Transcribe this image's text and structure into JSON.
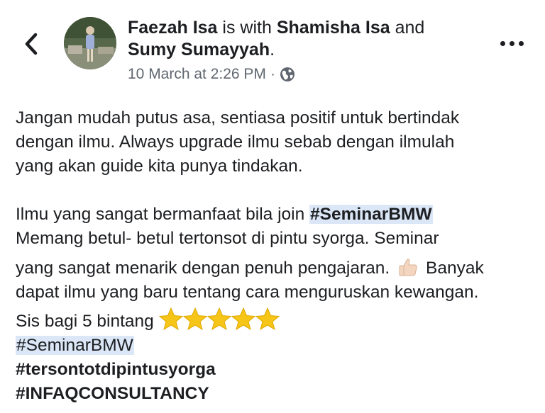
{
  "header": {
    "author": "Faezah Isa",
    "with_text": "is with",
    "tagged_1": "Shamisha Isa",
    "and_text": "and",
    "tagged_2": "Sumy Sumayyah",
    "period": ".",
    "timestamp": "10 March at 2:26 PM",
    "separator": "·",
    "privacy_icon": "globe-icon",
    "back_icon": "chevron-left-icon",
    "more_icon": "more-horizontal-icon"
  },
  "post": {
    "paragraph_1": [
      "Jangan mudah putus asa, sentiasa positif untuk bertindak",
      "dengan ilmu. Always upgrade ilmu sebab dengan ilmulah",
      "yang akan guide kita punya tindakan."
    ],
    "p2_line1_prefix": "Ilmu yang sangat bermanfaat bila join ",
    "p2_line1_tag": "#SeminarBMW",
    "p2_line2": "Memang betul- betul tertonsot di pintu syorga. Seminar",
    "p2_line3_prefix": "yang sangat menarik dengan penuh pengajaran.",
    "p2_line3_suffix": "Banyak",
    "p2_line4": "dapat ilmu yang baru tentang cara menguruskan kewangan.",
    "p2_line5": "Sis bagi 5 bintang",
    "star_count": 5,
    "hashtag_1": "#SeminarBMW",
    "hashtag_2": "#tersontotdipintusyorga",
    "hashtag_3": "#INFAQCONSULTANCY"
  },
  "colors": {
    "text": "#1c1e21",
    "meta": "#606770",
    "highlight": "#dbe7f7",
    "star": "#f5c518"
  }
}
